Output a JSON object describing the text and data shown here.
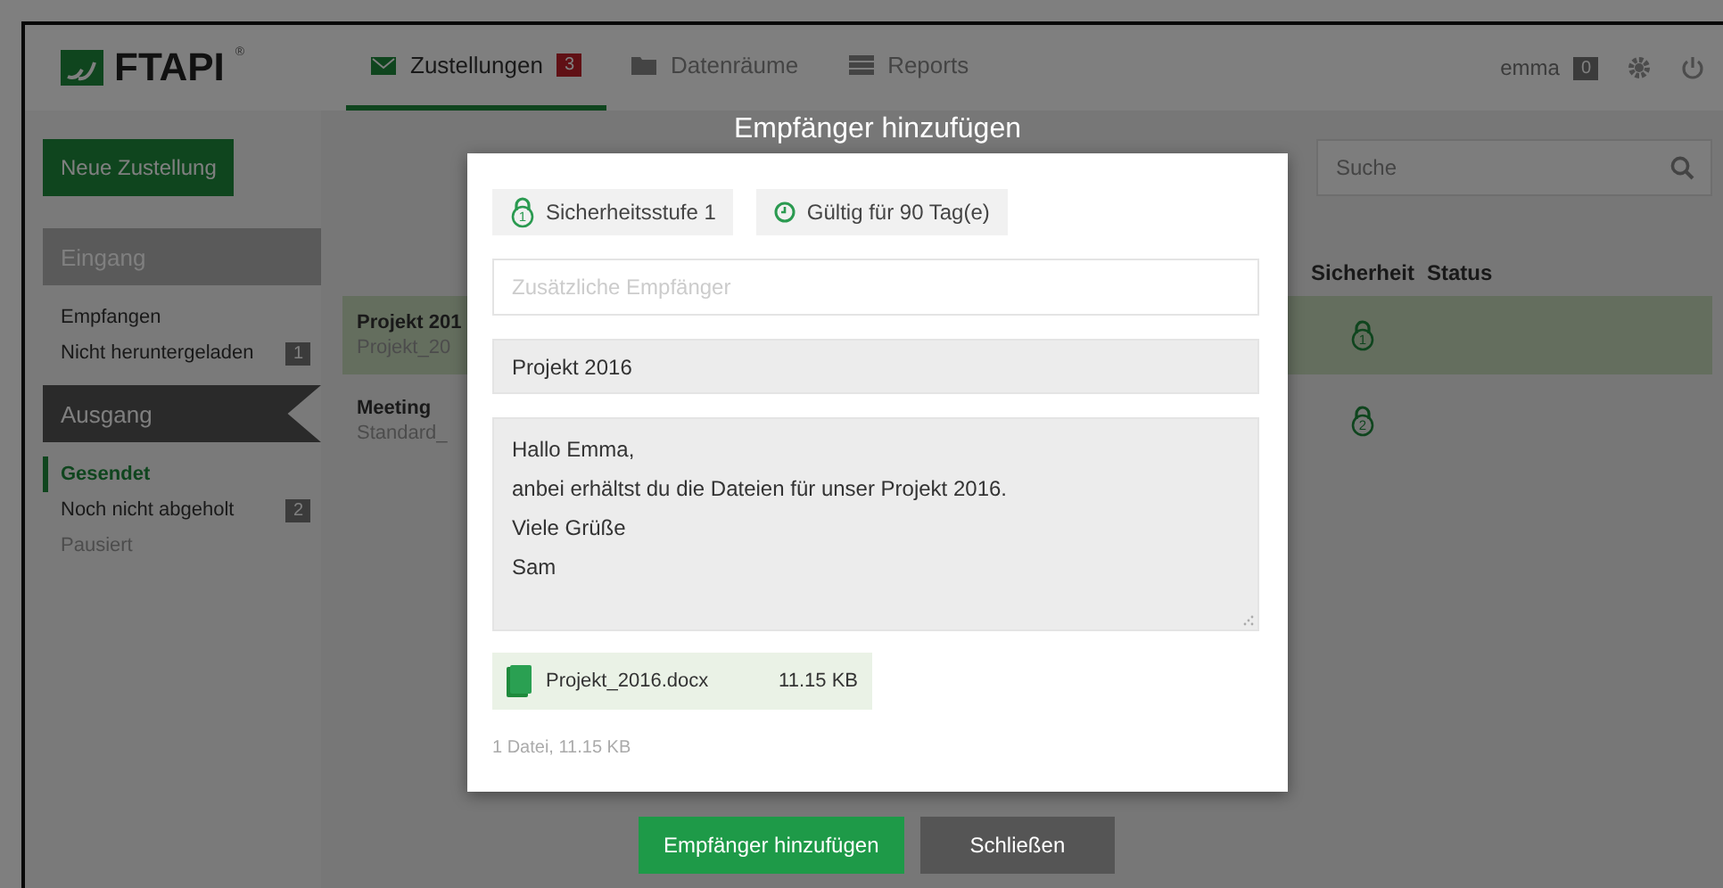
{
  "header": {
    "logo": "FTAPI",
    "logo_mark": "®",
    "tabs": [
      {
        "label": "Zustellungen",
        "badge": "3",
        "selected": true
      },
      {
        "label": "Datenräume",
        "selected": false
      },
      {
        "label": "Reports",
        "selected": false
      }
    ],
    "user": {
      "name": "emma",
      "badge": "0"
    }
  },
  "sidebar": {
    "new_button": "Neue Zustellung",
    "sections": [
      {
        "title": "Eingang",
        "selected": false,
        "items": [
          {
            "label": "Empfangen",
            "selected": false,
            "disabled": false
          },
          {
            "label": "Nicht heruntergeladen",
            "badge": "1",
            "selected": false,
            "disabled": false
          }
        ]
      },
      {
        "title": "Ausgang",
        "selected": true,
        "items": [
          {
            "label": "Gesendet",
            "selected": true,
            "disabled": false
          },
          {
            "label": "Noch nicht abgeholt",
            "badge": "2",
            "selected": false,
            "disabled": false
          },
          {
            "label": "Pausiert",
            "selected": false,
            "disabled": true
          }
        ]
      }
    ]
  },
  "search": {
    "placeholder": "Suche"
  },
  "table": {
    "columns": [
      "Sicherheit",
      "Status"
    ],
    "rows": [
      {
        "title": "Projekt 201",
        "subtitle": "Projekt_20",
        "security": "1",
        "selected": true
      },
      {
        "title": "Meeting",
        "subtitle": "Standard_",
        "security": "2",
        "selected": false
      }
    ]
  },
  "dialog": {
    "title": "Empfänger hinzufügen",
    "chips": [
      {
        "kind": "security",
        "label": "Sicherheitsstufe 1",
        "security": "1"
      },
      {
        "kind": "validity",
        "label": "Gültig für 90 Tag(e)"
      }
    ],
    "recipients": {
      "placeholder": "Zusätzliche Empfänger"
    },
    "subject": "Projekt 2016",
    "message": [
      "Hallo Emma,",
      "anbei erhältst du die Dateien für unser Projekt 2016.",
      "Viele Grüße",
      "Sam"
    ],
    "attachments": [
      {
        "name": "Projekt_2016.docx",
        "size": "11.15 KB"
      }
    ],
    "summary": "1 Datei, 11.15 KB",
    "buttons": [
      {
        "label": "Empfänger hinzufügen",
        "kind": "primary"
      },
      {
        "label": "Schließen",
        "kind": "secondary"
      }
    ]
  }
}
